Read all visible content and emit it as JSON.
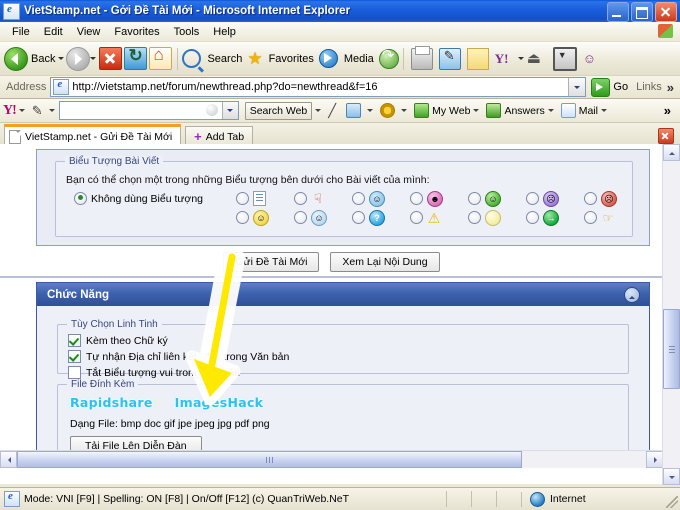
{
  "window": {
    "title": "VietStamp.net - Gởi Đề Tài Mới - Microsoft Internet Explorer",
    "icon": "ie-document-icon",
    "buttons": {
      "minimize": "Minimize",
      "maximize": "Maximize",
      "close": "Close"
    }
  },
  "menu": {
    "items": [
      "File",
      "Edit",
      "View",
      "Favorites",
      "Tools",
      "Help"
    ]
  },
  "toolbar": {
    "back_label": "Back",
    "search_label": "Search",
    "favorites_label": "Favorites",
    "media_label": "Media"
  },
  "address": {
    "label": "Address",
    "url": "http://vietstamp.net/forum/newthread.php?do=newthread&f=16",
    "go_label": "Go",
    "links_label": "Links"
  },
  "yahoo_toolbar": {
    "logo": "Y!",
    "search_value": "",
    "search_web_label": "Search Web",
    "my_web_label": "My Web",
    "answers_label": "Answers",
    "mail_label": "Mail",
    "overflow": "»"
  },
  "tabs": {
    "active_tab": "VietStamp.net - Gửi Đề Tài Mới",
    "add_tab_label": "Add Tab"
  },
  "forum": {
    "post_icons": {
      "legend": "Biểu Tượng Bài Viết",
      "description": "Bạn có thể chọn một trong những Biểu tượng bên dưới cho Bài viết của mình:",
      "no_icon_label": "Không dùng Biểu tượng",
      "no_icon_selected": true,
      "icons": [
        {
          "name": "document-icon",
          "class": "doc",
          "glyph": ""
        },
        {
          "name": "thumbs-down-icon",
          "class": "thumbdn",
          "glyph": "👎"
        },
        {
          "name": "smile-blue-icon",
          "class": "blue",
          "glyph": "☺"
        },
        {
          "name": "laugh-pink-icon",
          "class": "pink",
          "glyph": "☻"
        },
        {
          "name": "grin-green-icon",
          "class": "green",
          "glyph": "☺"
        },
        {
          "name": "confused-purple-icon",
          "class": "purple",
          "glyph": "☹"
        },
        {
          "name": "angry-red-icon",
          "class": "red",
          "glyph": "☹"
        },
        {
          "name": "smile-yellow-icon",
          "class": "yellow",
          "glyph": "☺"
        },
        {
          "name": "cool-sunglasses-icon",
          "class": "cool",
          "glyph": "☺"
        },
        {
          "name": "question-icon",
          "class": "cyan",
          "glyph": "?"
        },
        {
          "name": "warning-icon",
          "class": "warn",
          "glyph": "⚠"
        },
        {
          "name": "lightbulb-icon",
          "class": "bulb",
          "glyph": ""
        },
        {
          "name": "arrow-right-icon",
          "class": "arrow",
          "glyph": "→"
        },
        {
          "name": "thumbs-up-icon",
          "class": "thumbup",
          "glyph": "👍"
        }
      ]
    },
    "actions": {
      "submit_label": "Gửi Đề Tài Mới",
      "preview_label": "Xem Lại Nội Dung"
    },
    "functions_panel": {
      "title": "Chức Năng",
      "collapse_icon": "collapse-icon",
      "misc_options": {
        "legend": "Tùy Chọn Linh Tinh",
        "items": [
          {
            "label": "Kèm theo Chữ ký",
            "checked": true
          },
          {
            "label": "Tự nhận Địa chỉ liên kết URL trong Văn bản",
            "checked": true
          },
          {
            "label": "Tắt Biểu tượng vui trong văn bản",
            "checked": false
          }
        ]
      },
      "attachments": {
        "legend": "File Đính Kèm",
        "hosts": [
          "Rapidshare",
          "ImagesHack"
        ],
        "filetypes_label": "Dạng File: bmp doc gif jpe jpeg jpg pdf png",
        "upload_button": "Tải File Lên Diễn Đàn"
      }
    }
  },
  "annotation": {
    "type": "arrow",
    "color": "#ffe900",
    "direction": "down-left"
  },
  "statusbar": {
    "message": "Mode: VNI [F9] | Spelling: ON [F8] | On/Off [F12] (c) QuanTriWeb.NeT",
    "zone": "Internet"
  },
  "colors": {
    "titlebar": "#1b5fdd",
    "panel_header": "#3d62ae",
    "page_bg": "#e9ebf5",
    "fieldset_bg": "#eef0f8",
    "annotation": "#ffe900",
    "host_link": "#29c3f0"
  }
}
